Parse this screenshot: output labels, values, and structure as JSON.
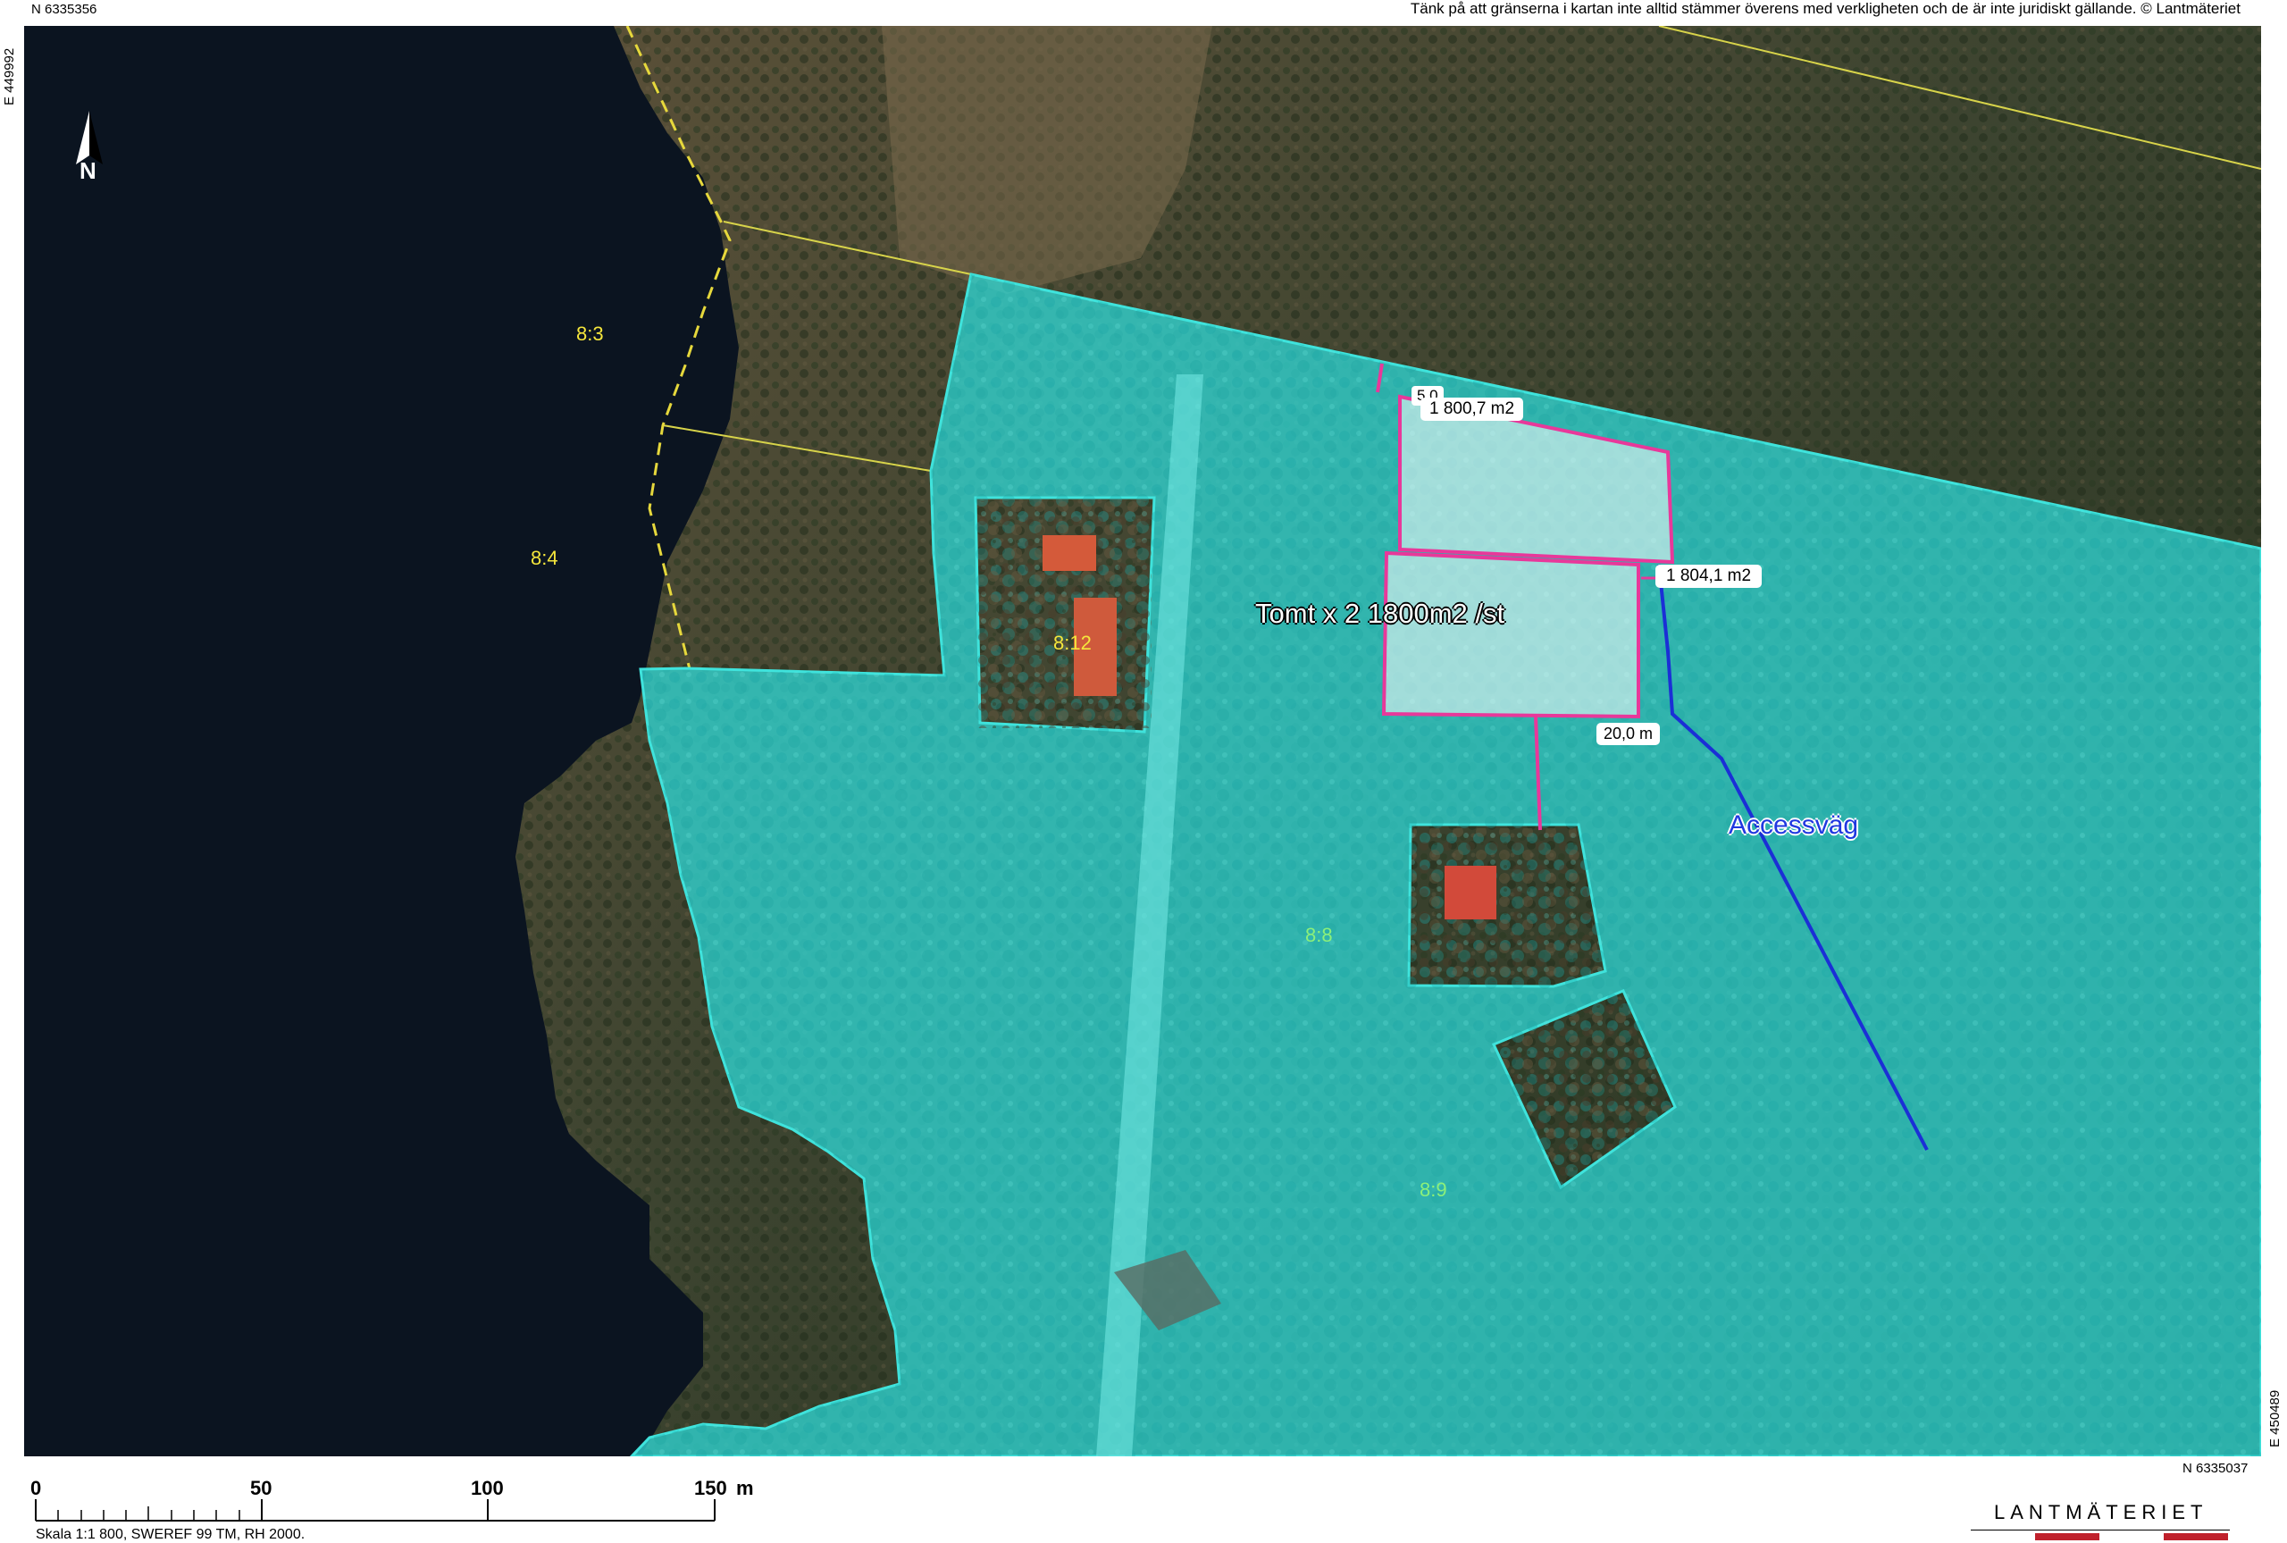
{
  "coordinates": {
    "north_top": "N 6335356",
    "east_left": "E 449992",
    "north_bottom": "N 6335037",
    "east_right": "E 450489"
  },
  "disclaimer": "Tänk på att gränserna i kartan inte alltid stämmer överens med verkligheten och de är inte juridiskt gällande. © Lantmäteriet",
  "north_arrow": {
    "icon": "north-arrow-icon",
    "label": "N"
  },
  "parcels": [
    {
      "label": "8:3",
      "color": "#f5e63c"
    },
    {
      "label": "8:4",
      "color": "#f5e63c"
    },
    {
      "label": "8:12",
      "color": "#f5e63c"
    },
    {
      "label": "8:8",
      "color": "#8cf07a"
    },
    {
      "label": "8:9",
      "color": "#8cf07a"
    }
  ],
  "annotations": {
    "plots_title": "Tomt x 2 1800m2 /st",
    "plot_a_area": "1 800,7 m2",
    "plot_b_area": "1 804,1 m2",
    "distance": "20,0 m",
    "access_road": "Accessväg",
    "small_label": "5,0"
  },
  "scale": {
    "ticks": [
      "0",
      "50",
      "100",
      "150"
    ],
    "unit": "m",
    "note": "Skala 1:1 800, SWEREF 99 TM, RH 2000."
  },
  "logo": "LANTMÄTERIET",
  "colors": {
    "parcel_fill": "#2fd5d2",
    "parcel_border": "#3fe3dc",
    "plot_border": "#e8389a",
    "access_road": "#1b2fd6",
    "property_line": "#d8d44a",
    "water": "#0b1420",
    "forest": "#3b4a2e",
    "logo_red": "#c0212c"
  }
}
